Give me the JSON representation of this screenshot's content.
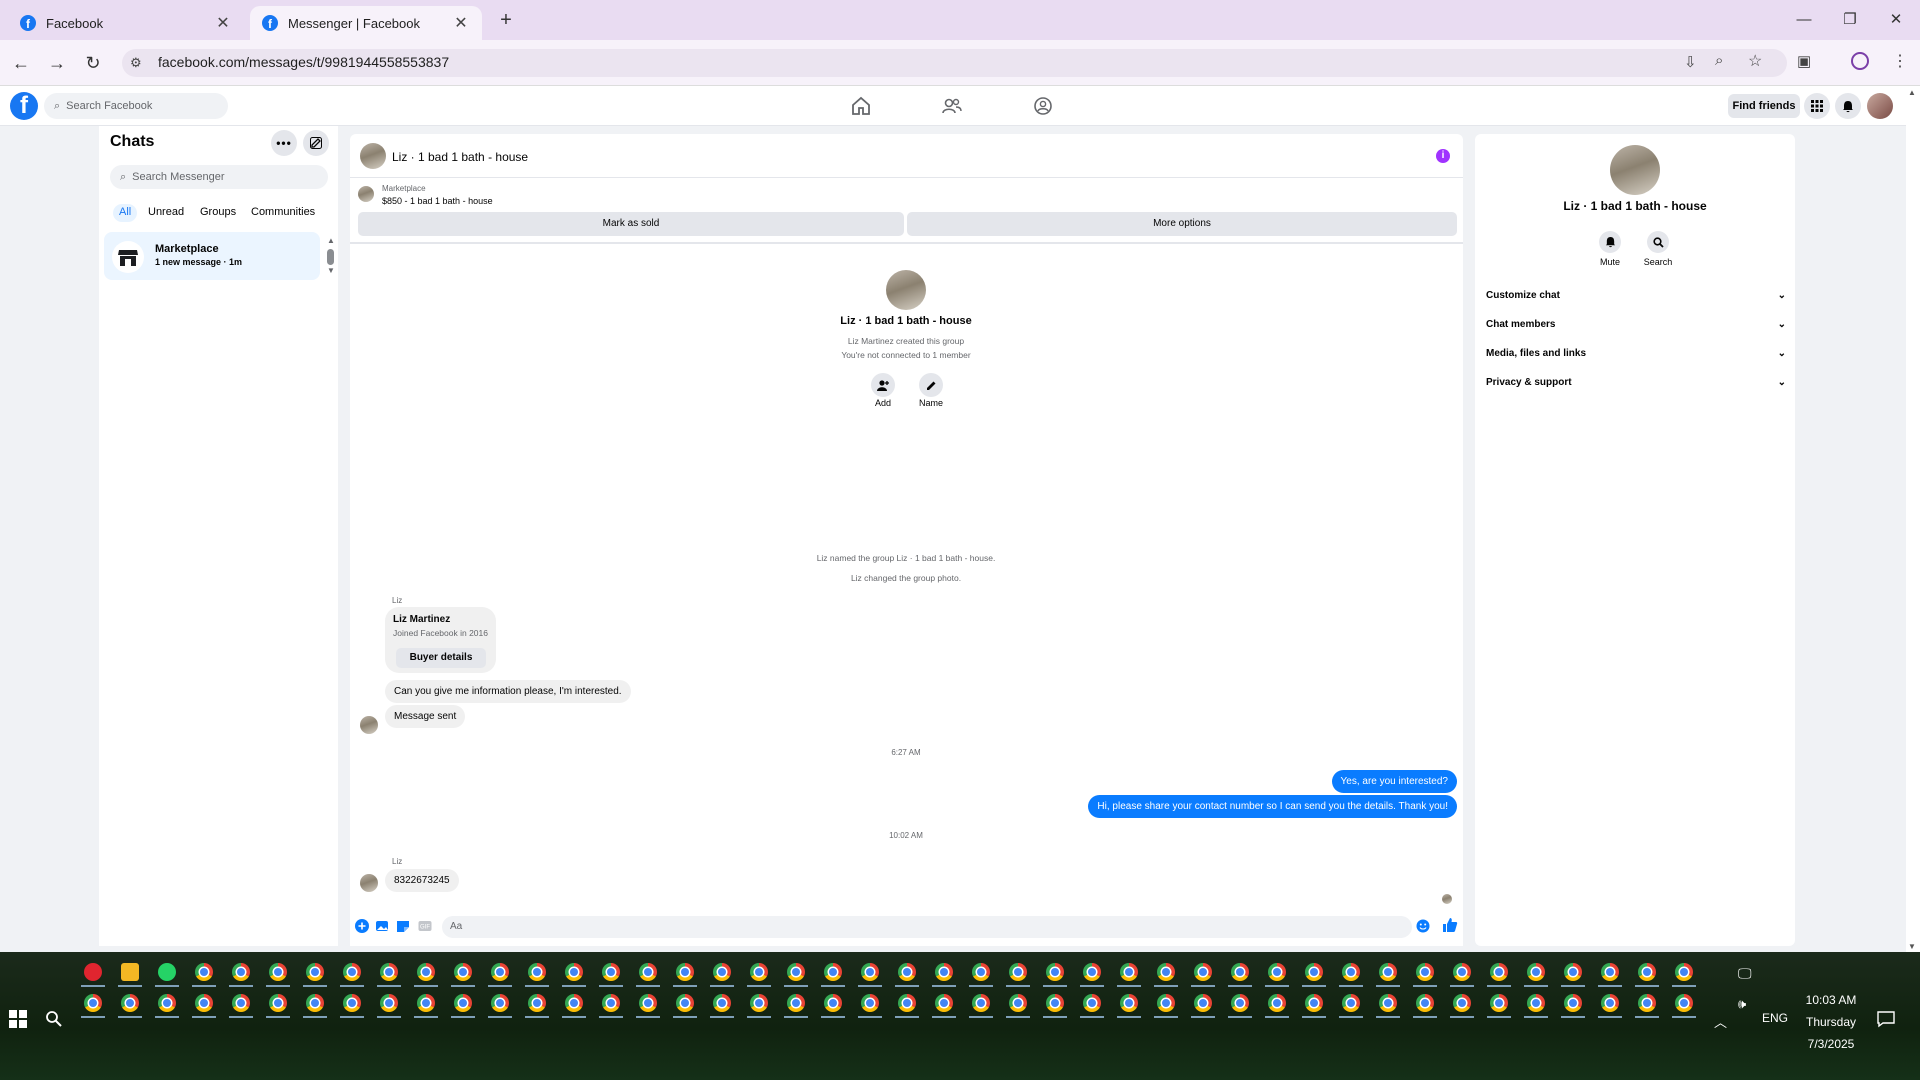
{
  "browser": {
    "tabs": [
      {
        "label": "Facebook",
        "active": false
      },
      {
        "label": "Messenger | Facebook",
        "active": true
      }
    ],
    "url": "facebook.com/messages/t/9981944558553837"
  },
  "fb_header": {
    "search_placeholder": "Search Facebook",
    "find_friends": "Find friends"
  },
  "sidebar": {
    "title": "Chats",
    "search_placeholder": "Search Messenger",
    "filters": [
      "All",
      "Unread",
      "Groups",
      "Communities"
    ],
    "selected_filter": "All",
    "chats": [
      {
        "name": "Marketplace",
        "subtitle": "1 new message · 1m"
      }
    ]
  },
  "conversation": {
    "title": "Liz · 1 bad 1 bath - house",
    "marketplace": {
      "label": "Marketplace",
      "listing": "$850 - 1 bad 1 bath - house",
      "mark_sold": "Mark as sold",
      "more_options": "More options"
    },
    "group_header": {
      "name": "Liz · 1 bad 1 bath - house",
      "created": "Liz Martinez created this group",
      "connection": "You're not connected to 1 member",
      "add_label": "Add",
      "name_label": "Name"
    },
    "system_messages": [
      "Liz named the group Liz · 1 bad 1 bath - house.",
      "Liz changed the group photo."
    ],
    "sender_name": "Liz",
    "profile_card": {
      "name": "Liz Martinez",
      "joined": "Joined Facebook in 2016",
      "button": "Buyer details"
    },
    "incoming_1": "Can you give me information please, I'm interested.",
    "incoming_2": "Message sent",
    "time_1": "6:27 AM",
    "outgoing_1": "Yes, are you interested?",
    "outgoing_2": "Hi, please share your contact number so I can send you the details. Thank you!",
    "time_2": "10:02 AM",
    "incoming_3": "8322673245",
    "composer_placeholder": "Aa"
  },
  "right_panel": {
    "name": "Liz · 1 bad 1 bath - house",
    "mute": "Mute",
    "search": "Search",
    "sections": [
      "Customize chat",
      "Chat members",
      "Media, files and links",
      "Privacy & support"
    ]
  },
  "taskbar": {
    "time": "10:03 AM",
    "day": "Thursday",
    "date": "7/3/2025",
    "lang": "ENG"
  },
  "colors": {
    "fb_blue": "#1877f2",
    "messenger_blue": "#0a7cff",
    "info_purple": "#a033ff",
    "tab_bar": "#e9dcf2"
  }
}
